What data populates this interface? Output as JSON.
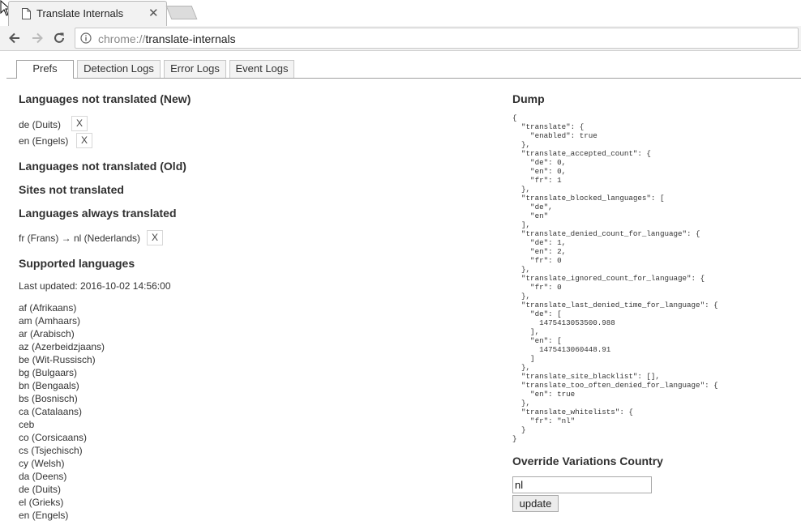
{
  "browser": {
    "tab_title": "Translate Internals",
    "tab_close": "✕",
    "url_scheme": "chrome://",
    "url_host": "translate-internals"
  },
  "page_tabs": [
    {
      "label": "Prefs",
      "selected": true
    },
    {
      "label": "Detection Logs",
      "selected": false
    },
    {
      "label": "Error Logs",
      "selected": false
    },
    {
      "label": "Event Logs",
      "selected": false
    }
  ],
  "prefs": {
    "not_translated_new": {
      "heading": "Languages not translated (New)",
      "items": [
        {
          "label": "de (Duits)",
          "remove": "X"
        },
        {
          "label": "en (Engels)",
          "remove": "X"
        }
      ]
    },
    "not_translated_old": {
      "heading": "Languages not translated (Old)"
    },
    "sites_not_translated": {
      "heading": "Sites not translated"
    },
    "always_translated": {
      "heading": "Languages always translated",
      "items": [
        {
          "label": "fr (Frans) → nl (Nederlands)",
          "remove": "X"
        }
      ]
    },
    "supported": {
      "heading": "Supported languages",
      "last_updated": "Last updated: 2016-10-02 14:56:00",
      "languages": [
        "af (Afrikaans)",
        "am (Amhaars)",
        "ar (Arabisch)",
        "az (Azerbeidzjaans)",
        "be (Wit-Russisch)",
        "bg (Bulgaars)",
        "bn (Bengaals)",
        "bs (Bosnisch)",
        "ca (Catalaans)",
        "ceb",
        "co (Corsicaans)",
        "cs (Tsjechisch)",
        "cy (Welsh)",
        "da (Deens)",
        "de (Duits)",
        "el (Grieks)",
        "en (Engels)"
      ]
    }
  },
  "dump": {
    "heading": "Dump",
    "text": "{\n  \"translate\": {\n    \"enabled\": true\n  },\n  \"translate_accepted_count\": {\n    \"de\": 0,\n    \"en\": 0,\n    \"fr\": 1\n  },\n  \"translate_blocked_languages\": [\n    \"de\",\n    \"en\"\n  ],\n  \"translate_denied_count_for_language\": {\n    \"de\": 1,\n    \"en\": 2,\n    \"fr\": 0\n  },\n  \"translate_ignored_count_for_language\": {\n    \"fr\": 0\n  },\n  \"translate_last_denied_time_for_language\": {\n    \"de\": [\n      1475413053500.988\n    ],\n    \"en\": [\n      1475413060448.91\n    ]\n  },\n  \"translate_site_blacklist\": [],\n  \"translate_too_often_denied_for_language\": {\n    \"en\": true\n  },\n  \"translate_whitelists\": {\n    \"fr\": \"nl\"\n  }\n}"
  },
  "override": {
    "heading": "Override Variations Country",
    "value": "nl",
    "button": "update"
  }
}
